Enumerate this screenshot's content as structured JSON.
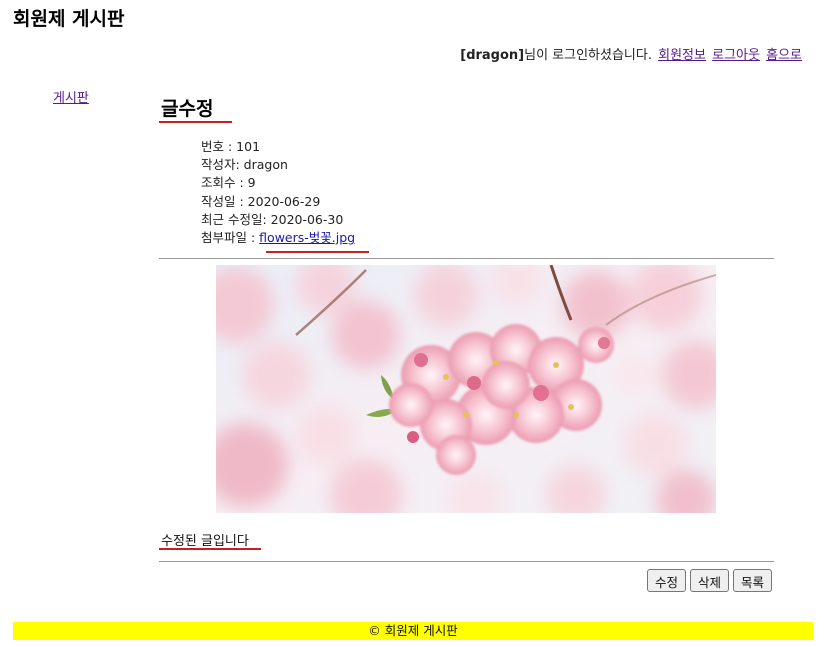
{
  "header": {
    "site_title": "회원제 게시판"
  },
  "user_bar": {
    "username": "[dragon]",
    "logged_in_text": "님이 로그인하셨습니다.",
    "links": {
      "member_info": "회원정보",
      "logout": "로그아웃",
      "home": "홈으로"
    }
  },
  "sidebar": {
    "board_link": "게시판"
  },
  "post": {
    "page_heading": "글수정",
    "meta": {
      "number": "번호 : 101",
      "author": "작성자: dragon",
      "views": "조회수 : 9",
      "created": "작성일 : 2020-06-29",
      "modified": "최근 수정일: 2020-06-30",
      "attachment_label": "첨부파일 : ",
      "attachment_file": "flowers-벚꽃.jpg"
    },
    "content": "수정된 글입니다"
  },
  "actions": {
    "edit": "수정",
    "delete": "삭제",
    "list": "목록"
  },
  "footer": {
    "copyright": "© 회원제 게시판"
  },
  "colors": {
    "accent_underline": "#cc1e1e",
    "footer_bg": "#ffff00",
    "visited_link": "#551a8b",
    "file_link": "#1a1aa6"
  }
}
